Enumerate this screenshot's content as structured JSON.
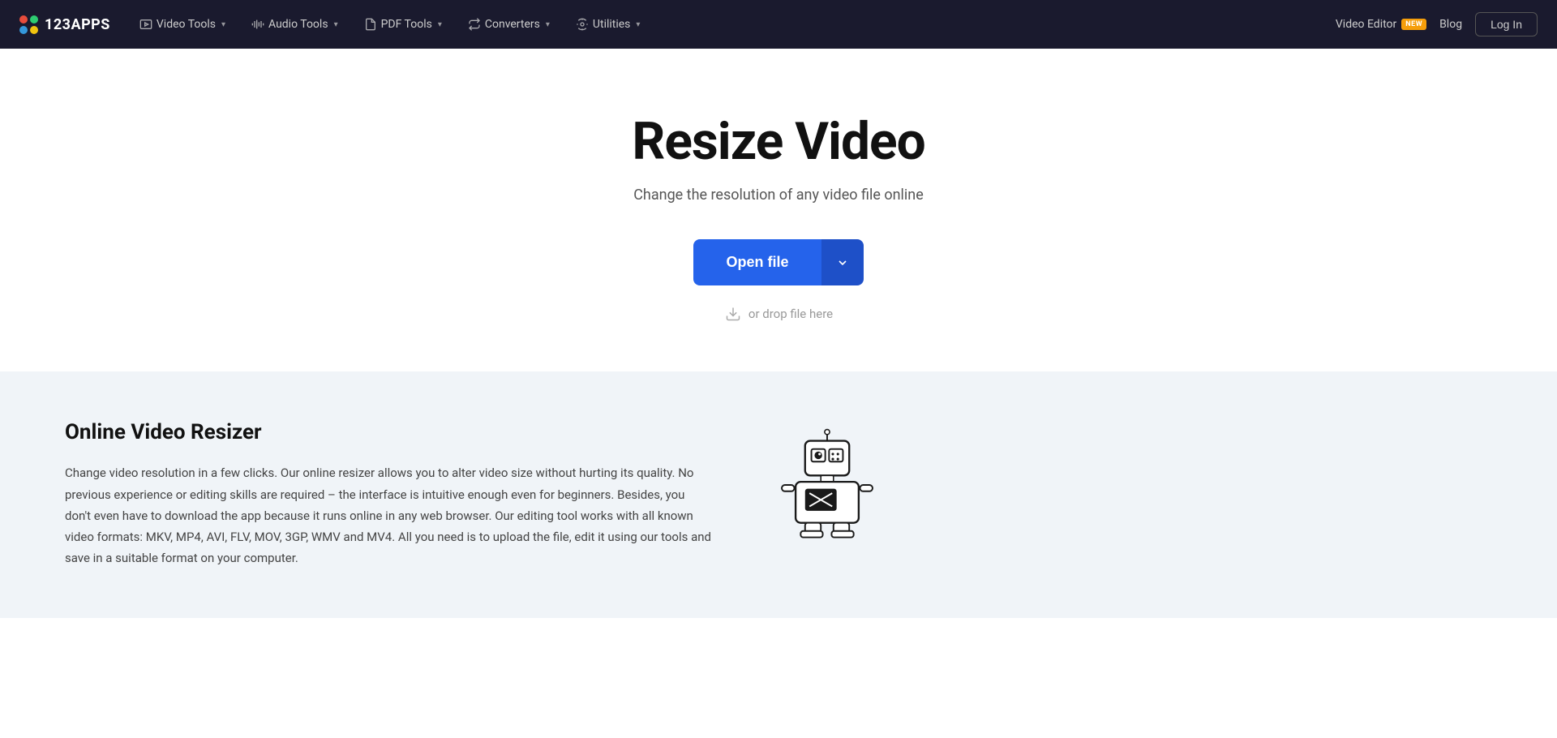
{
  "nav": {
    "logo_text": "123APPS",
    "items": [
      {
        "id": "video-tools",
        "label": "Video Tools",
        "has_chevron": true
      },
      {
        "id": "audio-tools",
        "label": "Audio Tools",
        "has_chevron": true
      },
      {
        "id": "pdf-tools",
        "label": "PDF Tools",
        "has_chevron": true
      },
      {
        "id": "converters",
        "label": "Converters",
        "has_chevron": true
      },
      {
        "id": "utilities",
        "label": "Utilities",
        "has_chevron": true
      }
    ],
    "right": {
      "video_editor_label": "Video Editor",
      "new_badge": "NEW",
      "blog_label": "Blog",
      "login_label": "Log In"
    }
  },
  "hero": {
    "title": "Resize Video",
    "subtitle": "Change the resolution of any video file online",
    "open_file_label": "Open file",
    "drop_hint": "or drop file here"
  },
  "bottom": {
    "title": "Online Video Resizer",
    "description": "Change video resolution in a few clicks. Our online resizer allows you to alter video size without hurting its quality. No previous experience or editing skills are required – the interface is intuitive enough even for beginners. Besides, you don't even have to download the app because it runs online in any web browser. Our editing tool works with all known video formats: MKV, MP4, AVI, FLV, MOV, 3GP, WMV and MV4. All you need is to upload the file, edit it using our tools and save in a suitable format on your computer."
  }
}
